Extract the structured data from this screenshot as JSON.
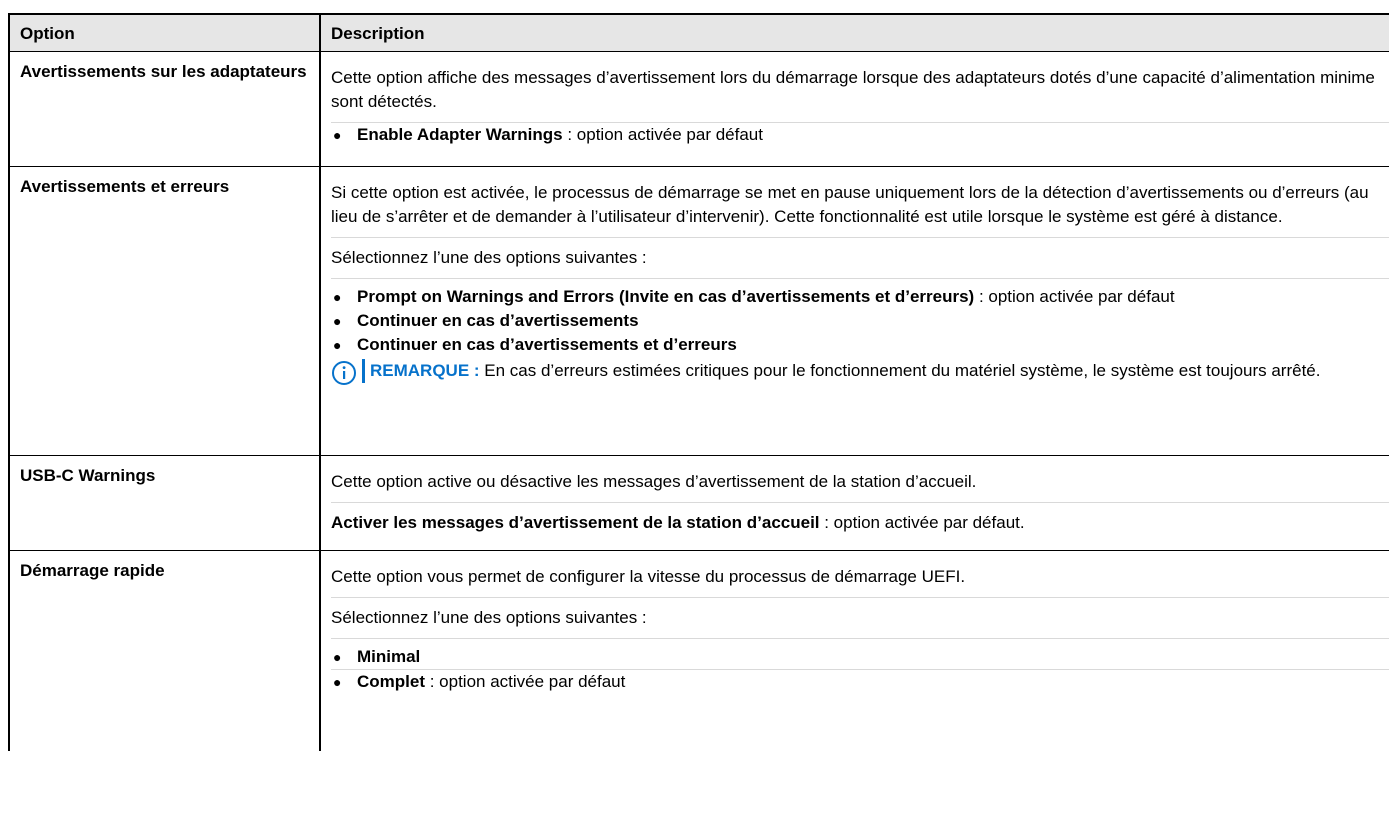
{
  "table": {
    "headers": {
      "option": "Option",
      "description": "Description"
    },
    "rows": [
      {
        "option": "Avertissements sur les adaptateurs",
        "description": "Cette option affiche des messages d’avertissement lors du démarrage lorsque des adaptateurs dotés d’une capacité d’alimentation minime sont détectés.",
        "bullet_bold": "Enable Adapter Warnings",
        "bullet_rest": " : option activée par défaut"
      },
      {
        "option": "Avertissements et erreurs",
        "description": "Si cette option est activée, le processus de démarrage se met en pause uniquement lors de la détection d’avertissements ou d’erreurs (au lieu de s’arrêter et de demander à l’utilisateur d’intervenir). Cette fonctionnalité est utile lorsque le système est géré à distance.",
        "select_text": "Sélectionnez l’une des options suivantes :",
        "bullets": [
          {
            "bold": "Prompt on Warnings and Errors (Invite en cas d’avertissements et d’erreurs)",
            "rest": " : option activée par défaut"
          },
          {
            "bold": "Continuer en cas d’avertissements",
            "rest": ""
          },
          {
            "bold": "Continuer en cas d’avertissements et d’erreurs",
            "rest": ""
          }
        ],
        "note_label": "REMARQUE :",
        "note_text": " En cas d’erreurs estimées critiques pour le fonctionnement du matériel système, le système est toujours arrêté."
      },
      {
        "option": "USB-C Warnings",
        "description": "Cette option active ou désactive les messages d’avertissement de la station d’accueil.",
        "setting_bold": "Activer les messages d’avertissement de la station d’accueil",
        "setting_rest": " : option activée par défaut."
      },
      {
        "option": "Démarrage rapide",
        "description": "Cette option vous permet de configurer la vitesse du processus de démarrage UEFI.",
        "select_text": "Sélectionnez l’une des options suivantes :",
        "bullets": [
          {
            "bold": "Minimal",
            "rest": ""
          },
          {
            "bold": "Complet",
            "rest": " : option activée par défaut"
          }
        ]
      }
    ]
  },
  "icons": {
    "info": "info-circle-icon",
    "bullet": "bullet-dot-icon"
  },
  "colors": {
    "header_bg": "#e6e6e6",
    "note_accent": "#0672cb"
  }
}
